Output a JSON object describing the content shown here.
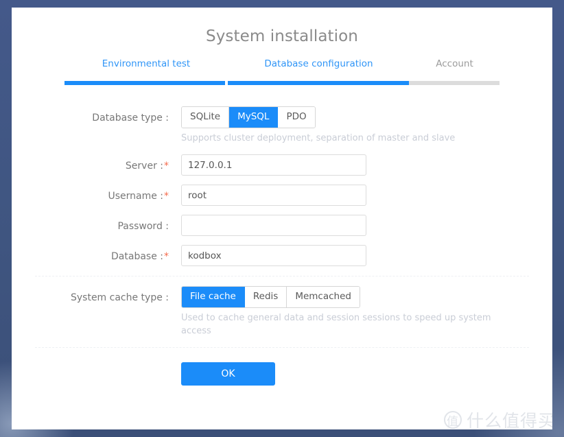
{
  "page": {
    "title": "System installation",
    "background_color": "#425a82",
    "accent_color": "#1b8cf9"
  },
  "steps": {
    "items": [
      {
        "label": "Environmental test",
        "state": "complete"
      },
      {
        "label": "Database configuration",
        "state": "active"
      },
      {
        "label": "Account",
        "state": "inactive"
      }
    ]
  },
  "form": {
    "database_type": {
      "label": "Database type :",
      "required": false,
      "options": [
        "SQLite",
        "MySQL",
        "PDO"
      ],
      "selected": "MySQL",
      "hint": "Supports cluster deployment, separation of master and slave"
    },
    "server": {
      "label": "Server :",
      "required": true,
      "value": "127.0.0.1",
      "placeholder": ""
    },
    "username": {
      "label": "Username :",
      "required": true,
      "value": "root",
      "placeholder": ""
    },
    "password": {
      "label": "Password :",
      "required": false,
      "value": "",
      "placeholder": ""
    },
    "database": {
      "label": "Database :",
      "required": true,
      "value": "kodbox",
      "placeholder": ""
    },
    "cache_type": {
      "label": "System cache type :",
      "required": false,
      "options": [
        "File cache",
        "Redis",
        "Memcached"
      ],
      "selected": "File cache",
      "hint": "Used to cache general data and session sessions to speed up system access"
    },
    "submit_label": "OK",
    "required_marker": "*"
  },
  "watermark": {
    "badge": "值",
    "text": "什么值得买"
  }
}
